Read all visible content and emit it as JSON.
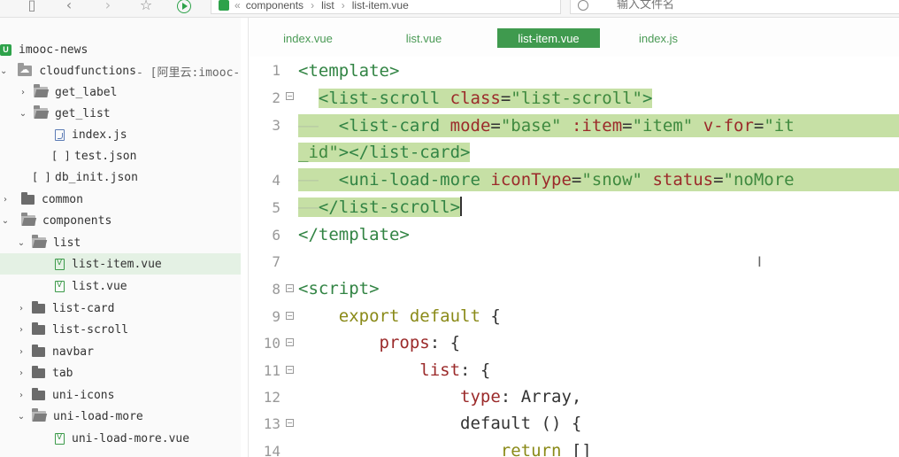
{
  "toolbar": {
    "breadcrumb": [
      "components",
      "list",
      "list-item.vue"
    ],
    "breadcrumb_sep": "«",
    "path_sep": "›",
    "search_placeholder": "输入文件名"
  },
  "sidebar": {
    "items": [
      {
        "label": "imooc-news",
        "extra": ""
      },
      {
        "label": "cloudfunctions",
        "extra": " - [阿里云:imooc-n"
      },
      {
        "label": "get_label",
        "extra": ""
      },
      {
        "label": "get_list",
        "extra": ""
      },
      {
        "label": "index.js",
        "extra": ""
      },
      {
        "label": "test.json",
        "extra": ""
      },
      {
        "label": "db_init.json",
        "extra": ""
      },
      {
        "label": "common",
        "extra": ""
      },
      {
        "label": "components",
        "extra": ""
      },
      {
        "label": "list",
        "extra": ""
      },
      {
        "label": "list-item.vue",
        "extra": ""
      },
      {
        "label": "list.vue",
        "extra": ""
      },
      {
        "label": "list-card",
        "extra": ""
      },
      {
        "label": "list-scroll",
        "extra": ""
      },
      {
        "label": "navbar",
        "extra": ""
      },
      {
        "label": "tab",
        "extra": ""
      },
      {
        "label": "uni-icons",
        "extra": ""
      },
      {
        "label": "uni-load-more",
        "extra": ""
      },
      {
        "label": "uni-load-more.vue",
        "extra": ""
      }
    ],
    "json_glyph": "[ ]",
    "arrow_right": "›",
    "arrow_down": "⌄"
  },
  "tabs": [
    {
      "label": "index.vue",
      "active": false
    },
    {
      "label": "list.vue",
      "active": false
    },
    {
      "label": "list-item.vue",
      "active": true
    },
    {
      "label": "index.js",
      "active": false
    }
  ],
  "editor": {
    "line_numbers": [
      "1",
      "2",
      "3",
      "",
      "4",
      "5",
      "6",
      "7",
      "8",
      "9",
      "10",
      "11",
      "12",
      "13",
      "14"
    ],
    "fold_marker": "−",
    "code": {
      "l1_tag": "<template>",
      "l2_tag_open": "<list-scroll",
      "l2_attr": "class",
      "l2_val": "\"list-scroll\"",
      "l2_close": ">",
      "l3_tag": "<list-card",
      "l3_a1": "mode",
      "l3_v1": "\"base\"",
      "l3_a2": ":item",
      "l3_v2": "\"item\"",
      "l3_a3": "v-for",
      "l3_v3": "\"it",
      "l3b_str": "_id\"",
      "l3b_tag": "></list-card>",
      "l4_tag": "<uni-load-more",
      "l4_a1": "iconType",
      "l4_v1": "\"snow\"",
      "l4_a2": "status",
      "l4_v2": "\"noMore",
      "l5_tag": "</list-scroll>",
      "l6_tag": "</template>",
      "l8_tag": "<script>",
      "l9_kw": "export default",
      "l9_rest": " {",
      "l10_prop": "props",
      "l10_rest": ": {",
      "l11_prop": "list",
      "l11_rest": ": {",
      "l12_prop": "type",
      "l12_colon": ": ",
      "l12_val": "Array",
      "l12_comma": ",",
      "l13_kw": "default",
      "l13_rest": " () {",
      "l14_kw": "return",
      "l14_rest": " []"
    }
  },
  "colors": {
    "accent_green": "#3f9a4e",
    "selection": "#c6e0a5",
    "tag": "#328444",
    "attr": "#9b2a2a",
    "keyword": "#8a8a18"
  }
}
